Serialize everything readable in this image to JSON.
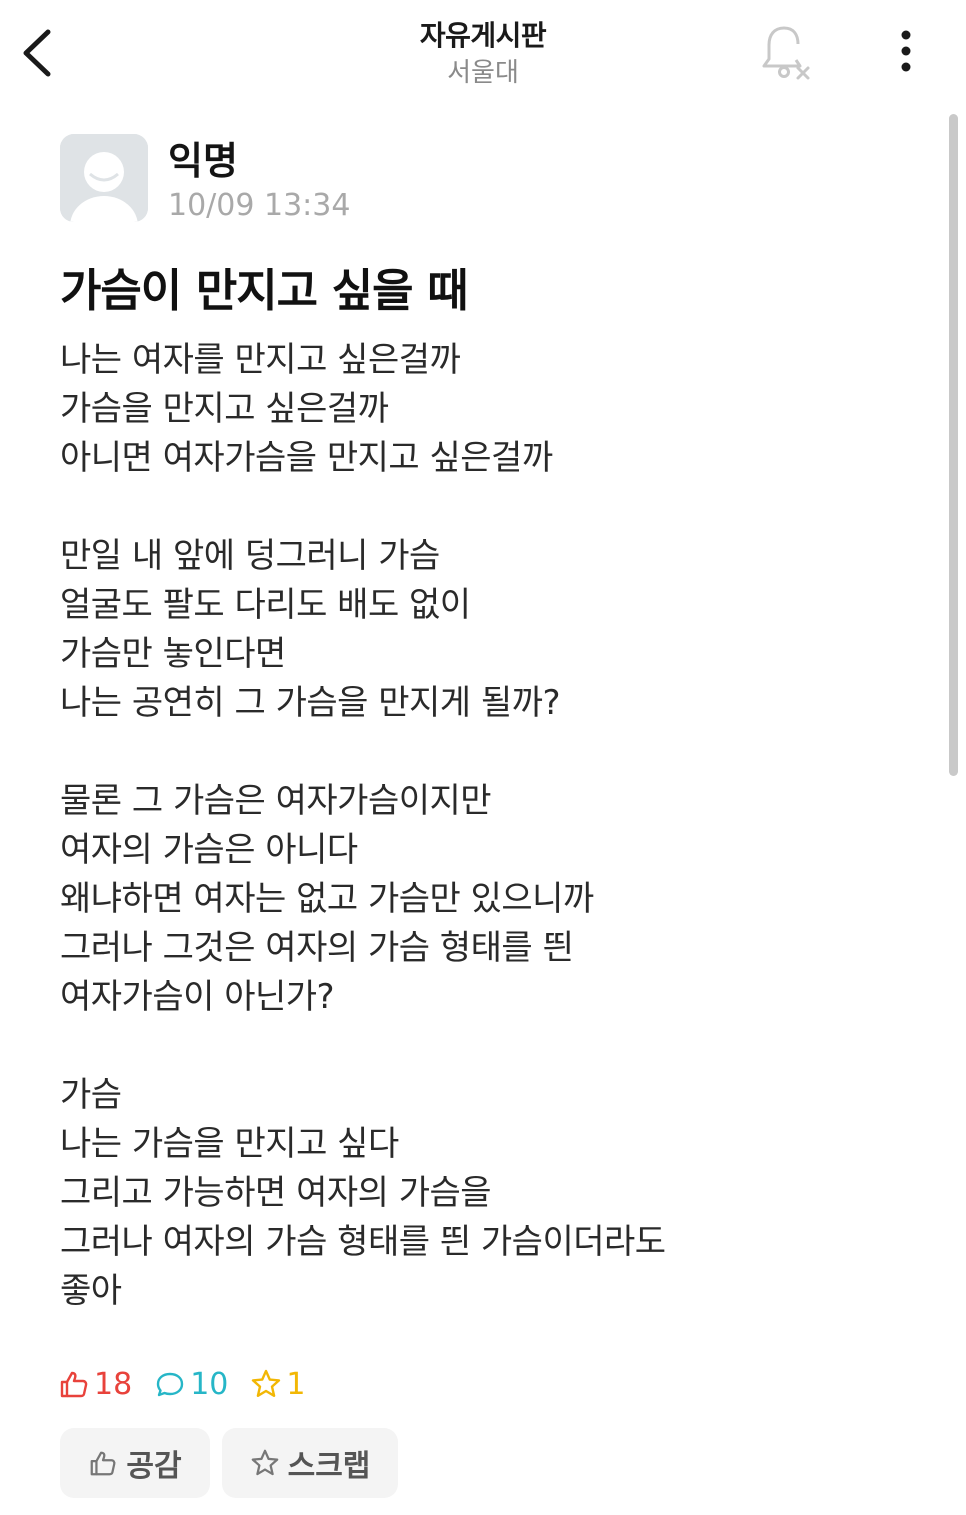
{
  "header": {
    "title": "자유게시판",
    "subtitle": "서울대"
  },
  "post": {
    "author": "익명",
    "time": "10/09 13:34",
    "title": "가슴이 만지고 싶을 때",
    "paragraphs": [
      [
        "나는 여자를 만지고 싶은걸까",
        "가슴을 만지고 싶은걸까",
        "아니면 여자가슴을 만지고 싶은걸까"
      ],
      [
        "만일 내 앞에 덩그러니 가슴",
        "얼굴도 팔도 다리도 배도 없이",
        "가슴만 놓인다면",
        "나는 공연히 그 가슴을 만지게 될까?"
      ],
      [
        "물론 그 가슴은 여자가슴이지만",
        "여자의 가슴은 아니다",
        "왜냐하면 여자는 없고 가슴만 있으니까",
        "그러나 그것은 여자의 가슴 형태를 띈",
        "여자가슴이 아닌가?"
      ],
      [
        "가슴",
        "나는 가슴을 만지고 싶다",
        "그리고 가능하면 여자의 가슴을",
        "그러나 여자의 가슴 형태를 띈 가슴이더라도",
        "좋아"
      ]
    ]
  },
  "stats": {
    "likes": "18",
    "comments": "10",
    "scraps": "1"
  },
  "actions": {
    "like_label": "공감",
    "scrap_label": "스크랩"
  },
  "colors": {
    "like": "#e8423b",
    "comment": "#26b6c7",
    "scrap": "#f2b705",
    "muted": "#a9a9a9"
  },
  "icons": {
    "back": "chevron-left-icon",
    "bell": "bell-off-icon",
    "more": "more-vertical-icon",
    "like": "thumbs-up-icon",
    "comment": "speech-bubble-icon",
    "scrap": "star-icon"
  }
}
